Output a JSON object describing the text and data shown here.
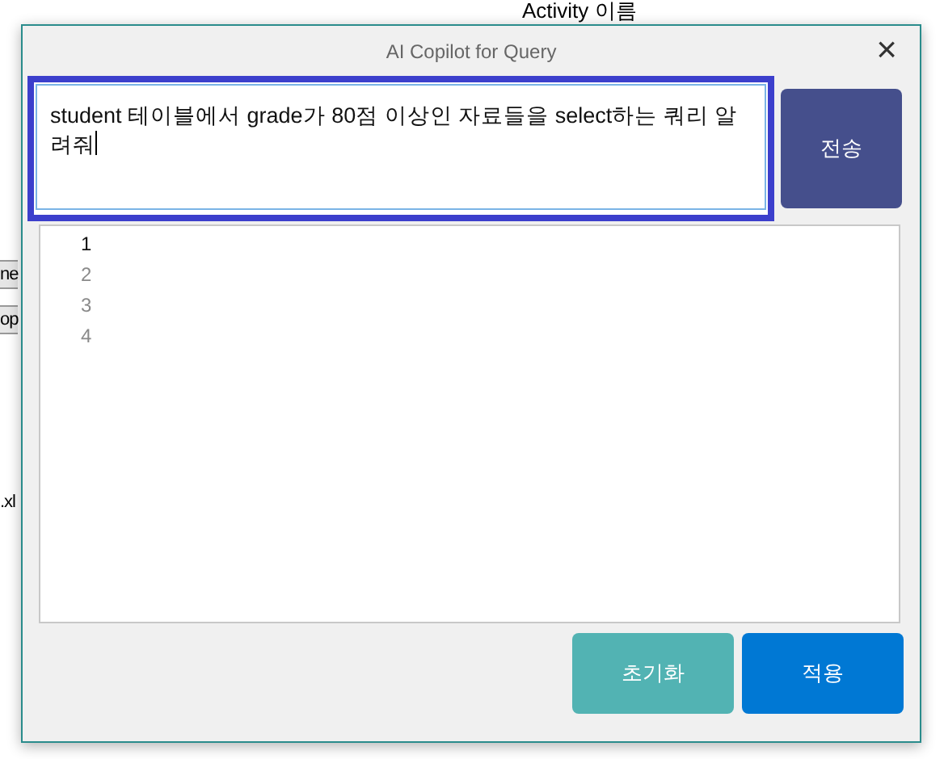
{
  "background": {
    "header_text": "Activity 이름",
    "side_fragments": [
      "ne",
      "op",
      ".xl"
    ]
  },
  "dialog": {
    "title": "AI Copilot for Query",
    "close": "×",
    "prompt": {
      "value": "student 테이블에서 grade가 80점 이상인 자료들을 select하는 쿼리 알려줘",
      "focused": true
    },
    "send_button": "전송",
    "editor": {
      "lines": [
        {
          "number": "1",
          "current": true
        },
        {
          "number": "2",
          "current": false
        },
        {
          "number": "3",
          "current": false
        },
        {
          "number": "4",
          "current": false
        }
      ]
    },
    "buttons": [
      {
        "label": "초기화",
        "kind": "reset"
      },
      {
        "label": "적용",
        "kind": "apply"
      }
    ]
  }
}
